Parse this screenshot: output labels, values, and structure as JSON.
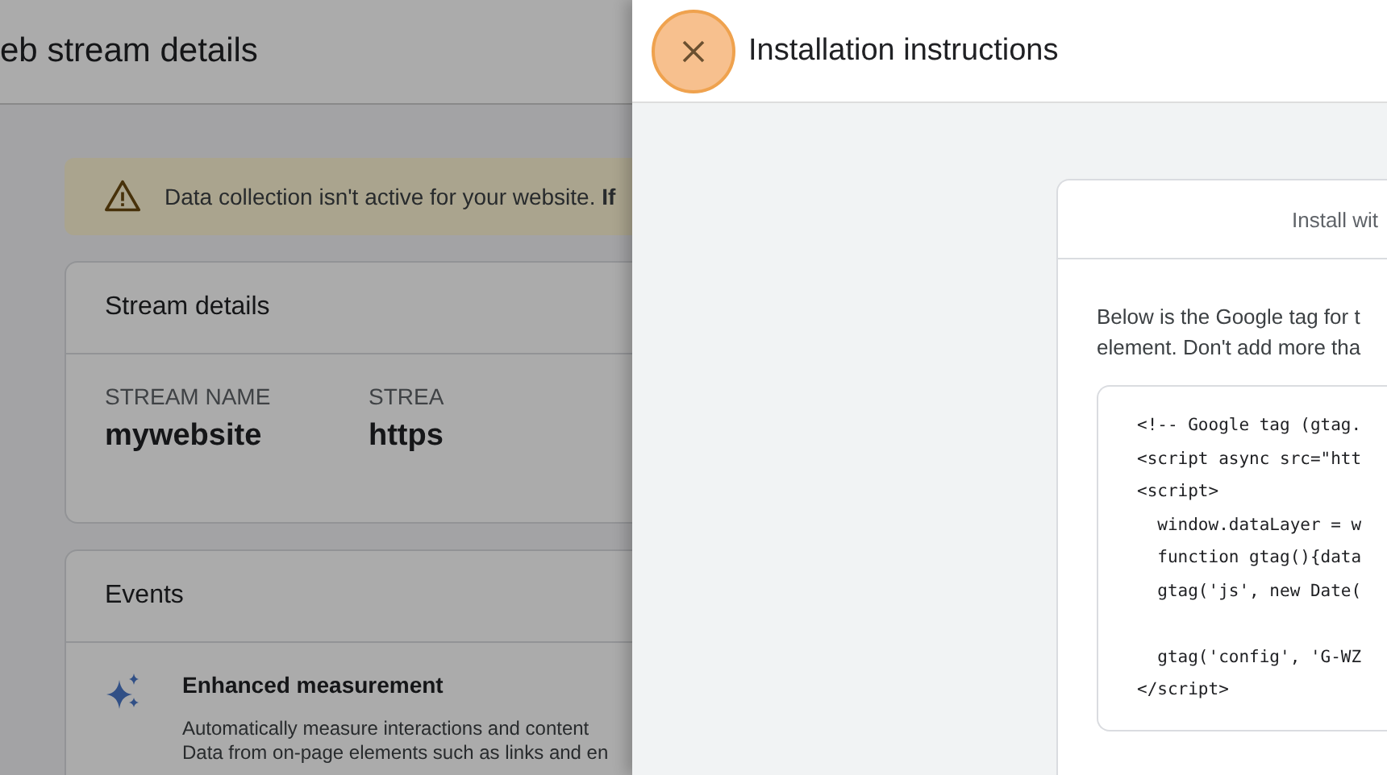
{
  "page": {
    "title": "eb stream details",
    "banner": {
      "text": "Data collection isn't active for your website. **If**"
    },
    "stream_details": {
      "title": "Stream details",
      "fields": [
        {
          "label": "STREAM NAME",
          "value": "mywebsite"
        },
        {
          "label": "STREA",
          "value": "https"
        }
      ]
    },
    "events": {
      "title": "Events",
      "feature": {
        "title": "Enhanced measurement",
        "lines": [
          "Automatically measure interactions and content",
          "Data from on-page elements such as links and en"
        ]
      }
    }
  },
  "panel": {
    "title": "Installation instructions",
    "card": {
      "tab": "Install wit",
      "description": [
        "Below is the Google tag for t",
        "element. Don't add more tha"
      ],
      "code_blocks": [
        [
          "<!-- Google tag (gtag.",
          "<script async src=\"htt",
          "<script>",
          "  window.dataLayer = w",
          "  function gtag(){data",
          "  gtag('js', new Date("
        ],
        [
          "  gtag('config', 'G-WZ",
          "</script>"
        ]
      ]
    }
  }
}
